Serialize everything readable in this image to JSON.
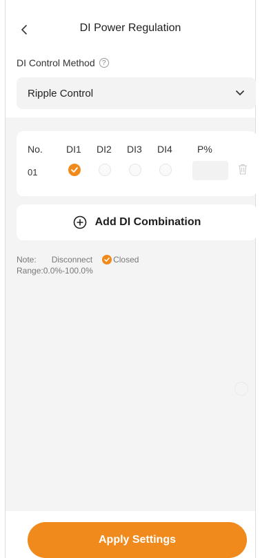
{
  "header": {
    "title": "DI Power Regulation",
    "back_icon": "chevron-left-icon"
  },
  "method": {
    "label": "DI Control Method",
    "help_symbol": "?",
    "selected": "Ripple Control"
  },
  "table": {
    "columns": [
      "No.",
      "DI1",
      "DI2",
      "DI3",
      "DI4",
      "P%"
    ],
    "rows": [
      {
        "no": "01",
        "di": [
          true,
          false,
          false,
          false
        ],
        "p_value": ""
      }
    ]
  },
  "add_combination": {
    "label": "Add DI Combination"
  },
  "note": {
    "prefix": "Note:",
    "disconnect": "Disconnect",
    "closed": "Closed",
    "range": "Range:0.0%-100.0%"
  },
  "footer": {
    "apply_label": "Apply Settings"
  },
  "colors": {
    "accent": "#f08a1c",
    "panel_bg": "#f4f4f4"
  }
}
